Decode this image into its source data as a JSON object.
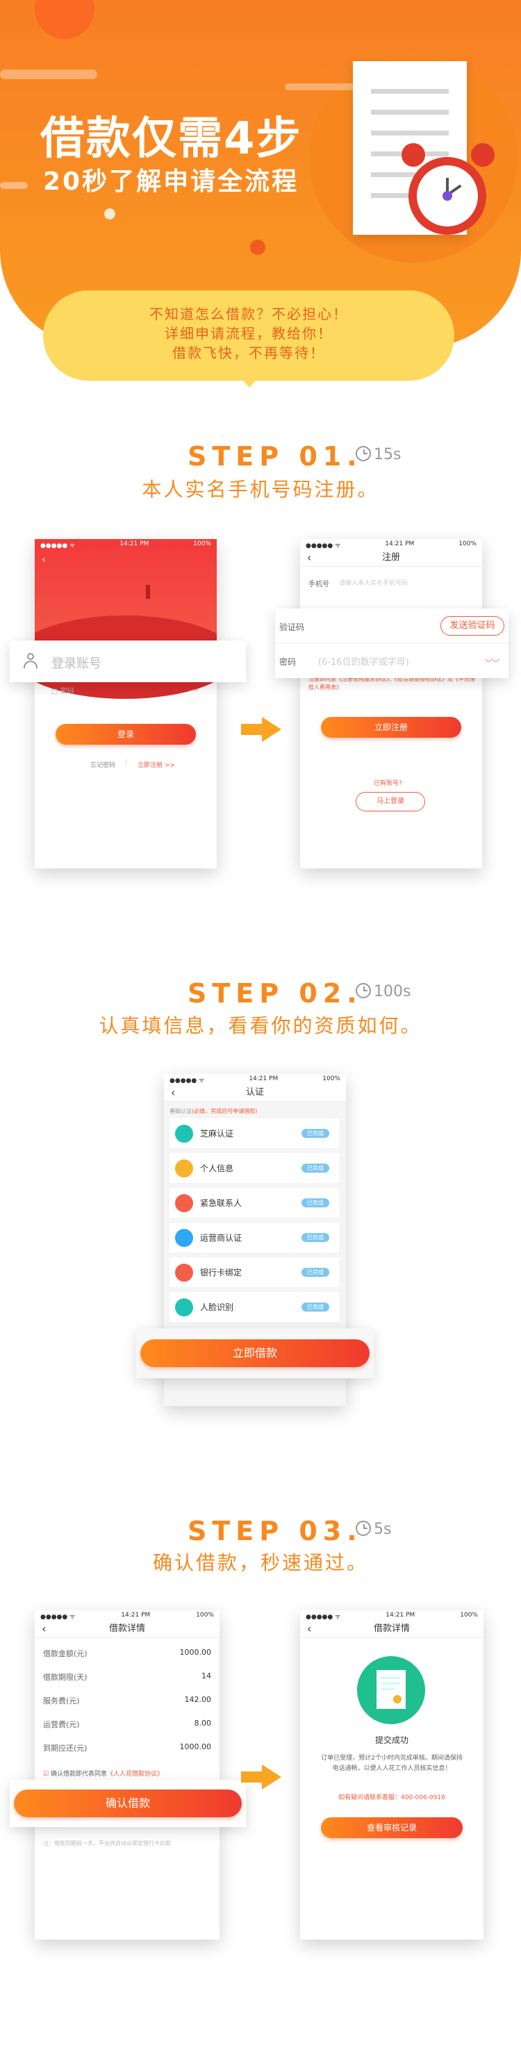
{
  "hero": {
    "title": "借款仅需4步",
    "subtitle": "20秒了解申请全流程",
    "bubble_lines": [
      "不知道怎么借款？不必担心！",
      "详细申请流程，教给你！",
      "借款飞快，不再等待！"
    ]
  },
  "steps": [
    {
      "label": "STEP 01.",
      "time": "15s",
      "desc": "本人实名手机号码注册。"
    },
    {
      "label": "STEP 02.",
      "time": "100s",
      "desc": "认真填信息，看看你的资质如何。"
    },
    {
      "label": "STEP 03.",
      "time": "5s",
      "desc": "确认借款，秒速通过。"
    }
  ],
  "status": {
    "time": "14:21 PM",
    "battery": "100%",
    "signal": "●●●●● ᯤ"
  },
  "login": {
    "account_placeholder": "登录账号",
    "password_placeholder": "密码",
    "login_button": "登录",
    "forgot": "忘记密码",
    "register_link": "立即注册 >>",
    "divider": "|"
  },
  "register": {
    "title": "注册",
    "phone_label": "手机号",
    "phone_placeholder": "请输入本人实名手机号码",
    "code_label": "验证码",
    "send_code": "发送验证码",
    "pwd_label": "密码",
    "pwd_placeholder": "(6-16位的数字或字母)",
    "agreement": "注册即同意《注册使用服务协议》、《征信调查授权协议》及《平台借款人费用表》",
    "register_button": "立即注册",
    "have_account": "已有账号?",
    "login_now": "马上登录"
  },
  "cert": {
    "title": "认证",
    "notice_label": "基础认证",
    "notice": "(必填，完成后可申请借款)",
    "items": [
      {
        "label": "芝麻认证",
        "tag": "已完成",
        "color": "#1fc3b3"
      },
      {
        "label": "个人信息",
        "tag": "已完成",
        "color": "#f7b32a"
      },
      {
        "label": "紧急联系人",
        "tag": "已完成",
        "color": "#f2604a"
      },
      {
        "label": "运营商认证",
        "tag": "已完成",
        "color": "#2ea8f0"
      },
      {
        "label": "银行卡绑定",
        "tag": "已完成",
        "color": "#f2604a"
      },
      {
        "label": "人脸识别",
        "tag": "已完成",
        "color": "#1fc3b3"
      }
    ],
    "borrow_button": "立即借款"
  },
  "loan": {
    "title": "借款详情",
    "rows": [
      {
        "label": "借款金额(元)",
        "value": "1000.00"
      },
      {
        "label": "借款期限(天)",
        "value": "14"
      },
      {
        "label": "服务费(元)",
        "value": "142.00"
      },
      {
        "label": "运营费(元)",
        "value": "8.00"
      },
      {
        "label": "到期应还(元)",
        "value": "1000.00"
      }
    ],
    "agree_text": "确认借款即代表同意",
    "agree_link": "《人人花借款协议》",
    "confirm_button": "确认借款",
    "footnote": "注：借款到期前一天，平台将自动从绑定银行卡扣款"
  },
  "success": {
    "title": "借款详情",
    "heading": "提交成功",
    "message": "订单已受理，预计2个小时内完成审核。期间请保持电话通畅，以便人人花工作人员核实信息！",
    "hotline": "如有疑问请联系客服：400-006-0918",
    "button": "查看审核记录"
  }
}
